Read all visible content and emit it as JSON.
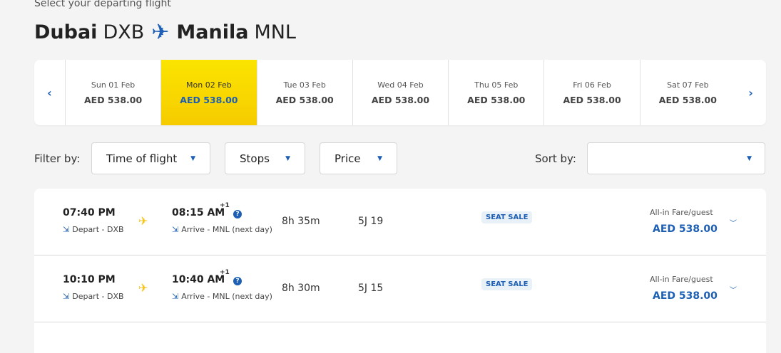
{
  "header": {
    "subtitle": "Select your departing flight",
    "origin_city": "Dubai",
    "origin_code": "DXB",
    "destination_city": "Manila",
    "destination_code": "MNL"
  },
  "date_strip": {
    "prev_icon": "chevron-left-icon",
    "next_icon": "chevron-right-icon",
    "days": [
      {
        "label": "Sun 01 Feb",
        "price": "AED 538.00",
        "selected": false
      },
      {
        "label": "Mon 02 Feb",
        "price": "AED 538.00",
        "selected": true
      },
      {
        "label": "Tue 03 Feb",
        "price": "AED 538.00",
        "selected": false
      },
      {
        "label": "Wed 04 Feb",
        "price": "AED 538.00",
        "selected": false
      },
      {
        "label": "Thu 05 Feb",
        "price": "AED 538.00",
        "selected": false
      },
      {
        "label": "Fri 06 Feb",
        "price": "AED 538.00",
        "selected": false
      },
      {
        "label": "Sat 07 Feb",
        "price": "AED 538.00",
        "selected": false
      }
    ]
  },
  "filters": {
    "label": "Filter by:",
    "time_of_flight": "Time of flight",
    "stops": "Stops",
    "price": "Price",
    "sort_label": "Sort by:",
    "sort_value": ""
  },
  "flights": [
    {
      "depart_time": "07:40 PM",
      "depart_label": "Depart - DXB",
      "arrive_time": "08:15 AM",
      "next_day_marker": "+1",
      "arrive_label": "Arrive - MNL (next day)",
      "duration": "8h 35m",
      "flight_number": "5J 19",
      "badge": "SEAT SALE",
      "fare_label": "All-in Fare/guest",
      "fare": "AED 538.00"
    },
    {
      "depart_time": "10:10 PM",
      "depart_label": "Depart - DXB",
      "arrive_time": "10:40 AM",
      "next_day_marker": "+1",
      "arrive_label": "Arrive - MNL (next day)",
      "duration": "8h 30m",
      "flight_number": "5J 15",
      "badge": "SEAT SALE",
      "fare_label": "All-in Fare/guest",
      "fare": "AED 538.00"
    }
  ],
  "colors": {
    "accent": "#1d5fb4",
    "selected_day": "#f6d600",
    "plane_icon": "#f5c518"
  }
}
